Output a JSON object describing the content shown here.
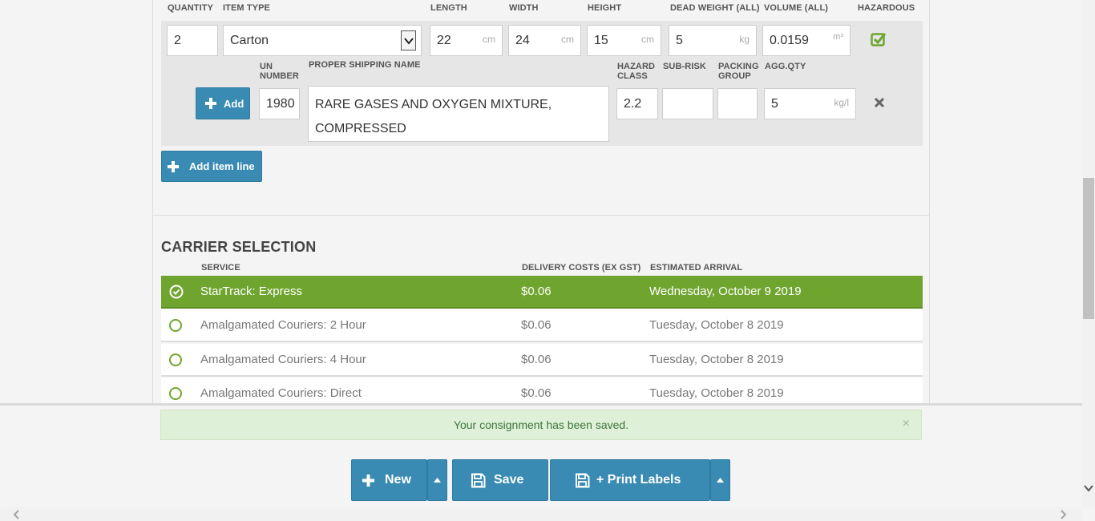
{
  "headers": {
    "quantity": "QUANTITY",
    "item_type": "ITEM TYPE",
    "length": "LENGTH",
    "width": "WIDTH",
    "height": "HEIGHT",
    "dead_weight": "DEAD WEIGHT (ALL)",
    "volume": "VOLUME (ALL)",
    "hazardous": "HAZARDOUS"
  },
  "item": {
    "quantity": "2",
    "item_type": "Carton",
    "length": "22",
    "length_unit": "cm",
    "width": "24",
    "width_unit": "cm",
    "height": "15",
    "height_unit": "cm",
    "weight": "5",
    "weight_unit": "kg",
    "volume": "0.0159",
    "volume_unit": "m³"
  },
  "hazard_headers": {
    "un_number": "UN NUMBER",
    "proper_shipping_name": "PROPER SHIPPING NAME",
    "hazard_class": "HAZARD CLASS",
    "sub_risk": "SUB-RISK",
    "packing_group": "PACKING GROUP",
    "agg_qty": "AGG.QTY"
  },
  "hazard": {
    "add_label": "Add",
    "un_number": "1980",
    "proper_shipping_name": "RARE GASES AND OXYGEN MIXTURE, COMPRESSED",
    "hazard_class": "2.2",
    "sub_risk": "",
    "packing_group": "",
    "agg_qty": "5",
    "agg_qty_unit": "kg/l"
  },
  "add_item_line_label": "Add item line",
  "carrier": {
    "title": "CARRIER SELECTION",
    "col_service": "SERVICE",
    "col_cost": "DELIVERY COSTS (EX GST)",
    "col_arrival": "ESTIMATED ARRIVAL",
    "rows": [
      {
        "service": "StarTrack: Express",
        "cost": "$0.06",
        "arrival": "Wednesday, October 9 2019",
        "selected": true
      },
      {
        "service": "Amalgamated Couriers: 2 Hour",
        "cost": "$0.06",
        "arrival": "Tuesday, October 8 2019",
        "selected": false
      },
      {
        "service": "Amalgamated Couriers: 4 Hour",
        "cost": "$0.06",
        "arrival": "Tuesday, October 8 2019",
        "selected": false
      },
      {
        "service": "Amalgamated Couriers: Direct",
        "cost": "$0.06",
        "arrival": "Tuesday, October 8 2019",
        "selected": false
      }
    ]
  },
  "alert": {
    "message": "Your consignment has been saved.",
    "close": "×"
  },
  "footer": {
    "new_label": "New",
    "save_label": "Save",
    "print_label": "+ Print Labels"
  },
  "colors": {
    "accent_blue": "#3a8bb4",
    "selected_green": "#6fa52e"
  }
}
